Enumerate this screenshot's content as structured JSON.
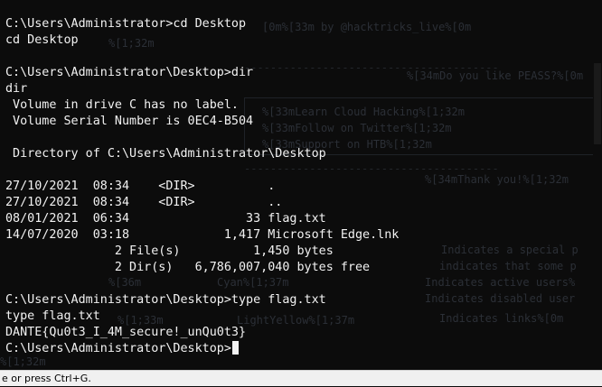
{
  "terminal": {
    "lines": [
      "C:\\Users\\Administrator>cd Desktop",
      "cd Desktop",
      "",
      "C:\\Users\\Administrator\\Desktop>dir",
      "dir",
      " Volume in drive C has no label.",
      " Volume Serial Number is 0EC4-B504",
      "",
      " Directory of C:\\Users\\Administrator\\Desktop",
      "",
      "27/10/2021  08:34    <DIR>          .",
      "27/10/2021  08:34    <DIR>          ..",
      "08/01/2021  06:34                33 flag.txt",
      "14/07/2020  03:18             1,417 Microsoft Edge.lnk",
      "               2 File(s)          1,450 bytes",
      "               2 Dir(s)   6,786,007,040 bytes free",
      "",
      "C:\\Users\\Administrator\\Desktop>type flag.txt",
      "type flag.txt",
      "DANTE{Qu0t3_I_4M_secure!_unQu0t3}",
      "C:\\Users\\Administrator\\Desktop>"
    ],
    "background_color": "#0c0c0c",
    "text_color": "#f2f2f2"
  },
  "background_ghost": {
    "banner": "[0m%[33m by @hacktricks_live%[0m",
    "cursor_marker": "%[1;32m",
    "like_peass": "%[34mDo you like PEASS?%[0m",
    "learn_cloud": "%[33mLearn Cloud Hacking%[1;32m",
    "follow_twitter": "%[33mFollow on Twitter%[1;32m",
    "support_htb": "%[33mSupport on HTB%[1;32m",
    "thank_you": "%[34mThank you!%[1;32m",
    "legend_special": "Indicates a special p",
    "legend_some": "indicates that some p",
    "legend_active": "Indicates active users%",
    "legend_disabled": "Indicates disabled user",
    "legend_links": "Indicates links%[0m",
    "marker_36": "%[36m",
    "cyan": "Cyan%[1;37m",
    "marker_33": "%[1;33m",
    "lightyellow": "LightYellow%[1;37m",
    "left_marker": "%[1;32m"
  },
  "statusbar": {
    "text": "e or press Ctrl+G."
  }
}
